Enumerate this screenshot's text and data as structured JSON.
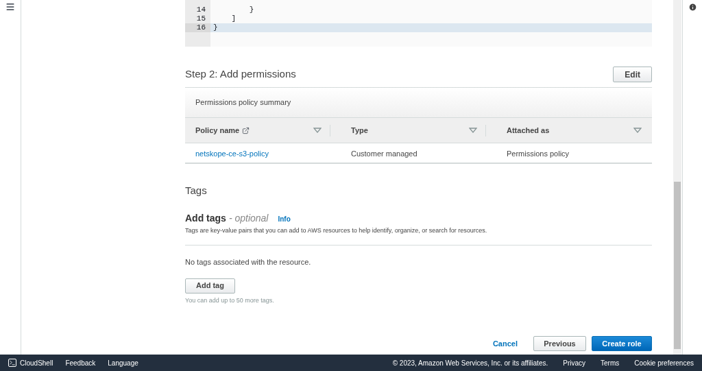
{
  "editor": {
    "lines": [
      {
        "number": "14",
        "code": "        }",
        "active": false
      },
      {
        "number": "15",
        "code": "    ]",
        "active": false
      },
      {
        "number": "16",
        "code": "}",
        "active": true
      }
    ]
  },
  "permissions": {
    "title": "Step 2: Add permissions",
    "edit_button": "Edit",
    "summary_title": "Permissions policy summary",
    "columns": [
      {
        "label": "Policy name",
        "external": true
      },
      {
        "label": "Type",
        "external": false
      },
      {
        "label": "Attached as",
        "external": false
      }
    ],
    "rows": [
      {
        "policy_name": "netskope-ce-s3-policy",
        "type": "Customer managed",
        "attached_as": "Permissions policy"
      }
    ]
  },
  "tags": {
    "section_title": "Tags",
    "heading": "Add tags",
    "optional": "- optional",
    "info": "Info",
    "description": "Tags are key-value pairs that you can add to AWS resources to help identify, organize, or search for resources.",
    "empty": "No tags associated with the resource.",
    "add_button": "Add tag",
    "hint": "You can add up to 50 more tags."
  },
  "actions": {
    "cancel": "Cancel",
    "previous": "Previous",
    "create": "Create role"
  },
  "footer": {
    "cloudshell": "CloudShell",
    "feedback": "Feedback",
    "language": "Language",
    "copyright": "© 2023, Amazon Web Services, Inc. or its affiliates.",
    "links": [
      "Privacy",
      "Terms",
      "Cookie preferences"
    ]
  }
}
